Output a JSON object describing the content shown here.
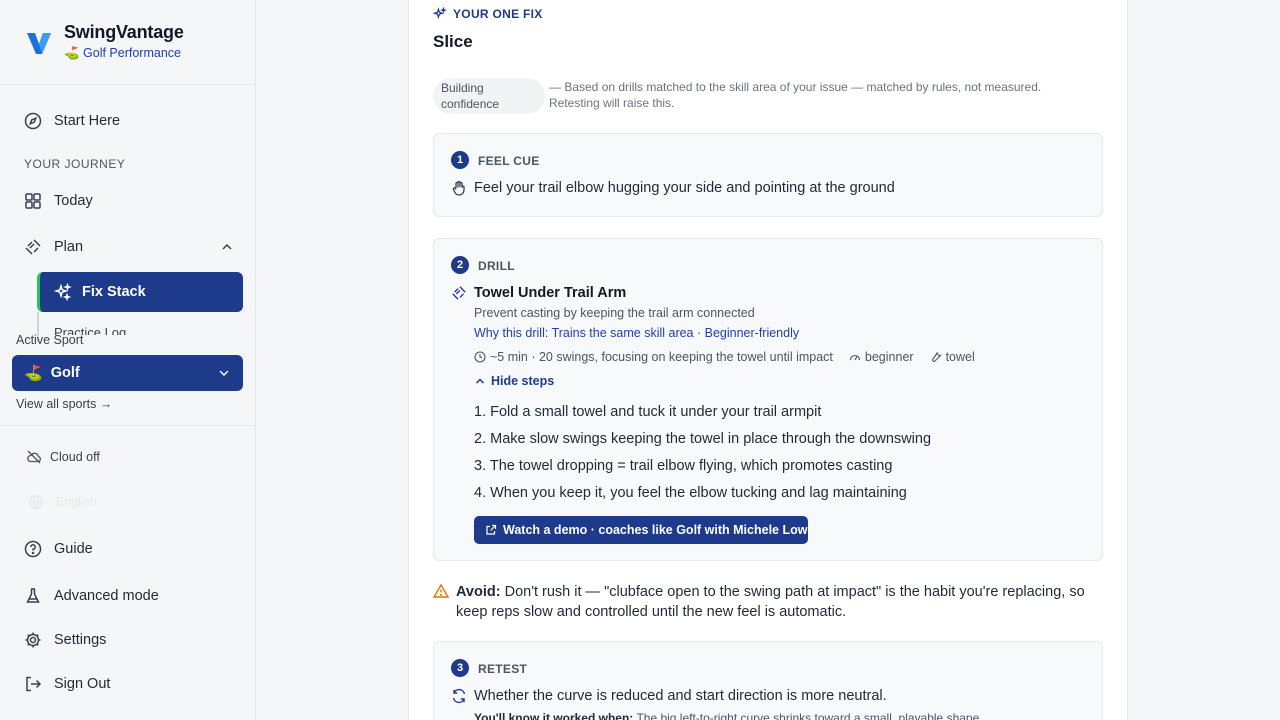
{
  "brand": {
    "title": "SwingVantage",
    "subtitle": "⛳ Golf Performance"
  },
  "nav": {
    "start_here": "Start Here",
    "journey_heading": "YOUR JOURNEY",
    "today": "Today",
    "plan": "Plan",
    "fix_stack": "Fix Stack",
    "peek_item": "Practice Log",
    "active_sport_label": "Active Sport",
    "sport_flag": "⛳",
    "sport_value": "Golf",
    "view_all": "View all sports →",
    "cloud": "Cloud off",
    "language": "English",
    "guide": "Guide",
    "advanced": "Advanced mode",
    "settings": "Settings",
    "sign_out": "Sign Out"
  },
  "fix": {
    "eyebrow": "YOUR ONE FIX",
    "issue": "Slice",
    "confidence_badge": "Building confidence",
    "confidence_note": "— Based on drills matched to the skill area of your issue — matched by rules, not measured. Retesting will raise this.",
    "feel": {
      "num": "1",
      "label": "FEEL CUE",
      "text": "Feel your trail elbow hugging your side and pointing at the ground"
    },
    "drill": {
      "num": "2",
      "label": "DRILL",
      "title": "Towel Under Trail Arm",
      "desc": "Prevent casting by keeping the trail arm connected",
      "why": "Why this drill: Trains the same skill area · Beginner-friendly",
      "duration": "~5 min · 20 swings, focusing on keeping the towel until impact",
      "level": "beginner",
      "equipment": "towel",
      "hide_steps": "Hide steps",
      "steps": [
        "1. Fold a small towel and tuck it under your trail armpit",
        "2. Make slow swings keeping the towel in place through the downswing",
        "3. The towel dropping = trail elbow flying, which promotes casting",
        "4. When you keep it, you feel the elbow tucking and lag maintaining"
      ],
      "demo_button": "Watch a demo · coaches like Golf with Michele Low"
    },
    "avoid": {
      "label": "Avoid:",
      "text": "Don't rush it — \"clubface open to the swing path at impact\" is the habit you're replacing, so keep reps slow and controlled until the new feel is automatic."
    },
    "retest": {
      "num": "3",
      "label": "RETEST",
      "text": "Whether the curve is reduced and start direction is more neutral.",
      "known_label": "You'll know it worked when:",
      "known_text": "The big left-to-right curve shrinks toward a small, playable shape."
    }
  },
  "colors": {
    "primary": "#1e3a8a",
    "accent": "#22c55e",
    "warning": "#d97706"
  }
}
